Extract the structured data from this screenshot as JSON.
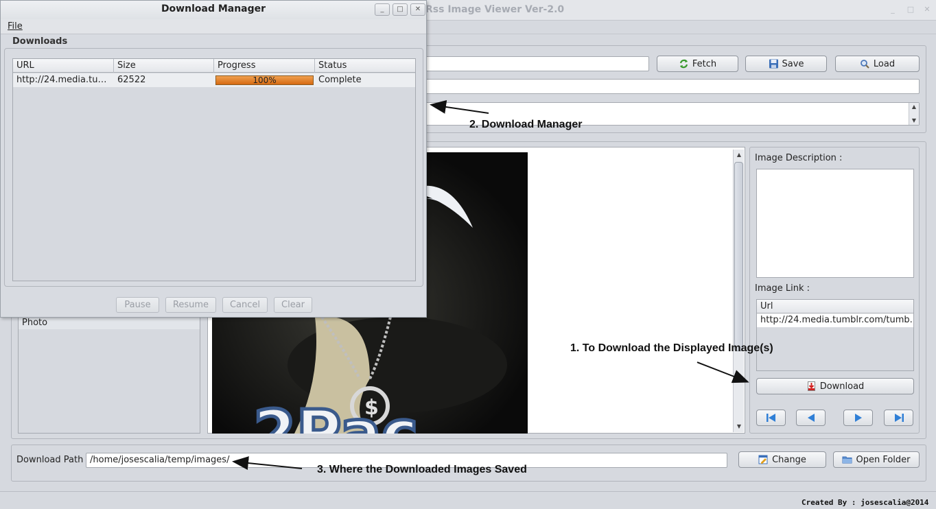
{
  "main_window": {
    "title": "Rss Image Viewer Ver-2.0",
    "toolbar": {
      "fetch_label": "Fetch",
      "save_label": "Save",
      "load_label": "Load"
    },
    "category_list": {
      "visible_item": "Photo"
    },
    "image_description_label": "Image Description :",
    "image_link_label": "Image Link :",
    "image_link_table": {
      "header": "Url",
      "row": "http://24.media.tumblr.com/tumb..."
    },
    "download_button_label": "Download",
    "download_path": {
      "label": "Download Path",
      "value": "/home/josescalia/temp/images/",
      "change_label": "Change",
      "open_folder_label": "Open Folder"
    },
    "credits": "Created By : josescalia@2014"
  },
  "annotations": {
    "download_displayed": "1. To Download the Displayed Image(s)",
    "download_manager": "2. Download Manager",
    "where_saved": "3. Where the Downloaded Images Saved"
  },
  "download_manager": {
    "title": "Download Manager",
    "menu": {
      "file_label": "File"
    },
    "section_title": "Downloads",
    "columns": [
      "URL",
      "Size",
      "Progress",
      "Status"
    ],
    "rows": [
      {
        "url": "http://24.media.tum...",
        "size": "62522",
        "progress_label": "100%",
        "progress_value": 100,
        "status": "Complete"
      }
    ],
    "buttons": {
      "pause": "Pause",
      "resume": "Resume",
      "cancel": "Cancel",
      "clear": "Clear"
    }
  },
  "colors": {
    "progress_fill": "#e07a1c",
    "window_bg": "#d6d9df",
    "accent_blue": "#2f7fd6"
  },
  "icons": {
    "fetch": "refresh-icon",
    "save": "floppy-disk-icon",
    "load": "magnifier-icon",
    "download": "pdf-download-icon",
    "change": "edit-icon",
    "open_folder": "folder-icon",
    "nav": [
      "first-icon",
      "previous-icon",
      "next-icon",
      "last-icon"
    ]
  }
}
